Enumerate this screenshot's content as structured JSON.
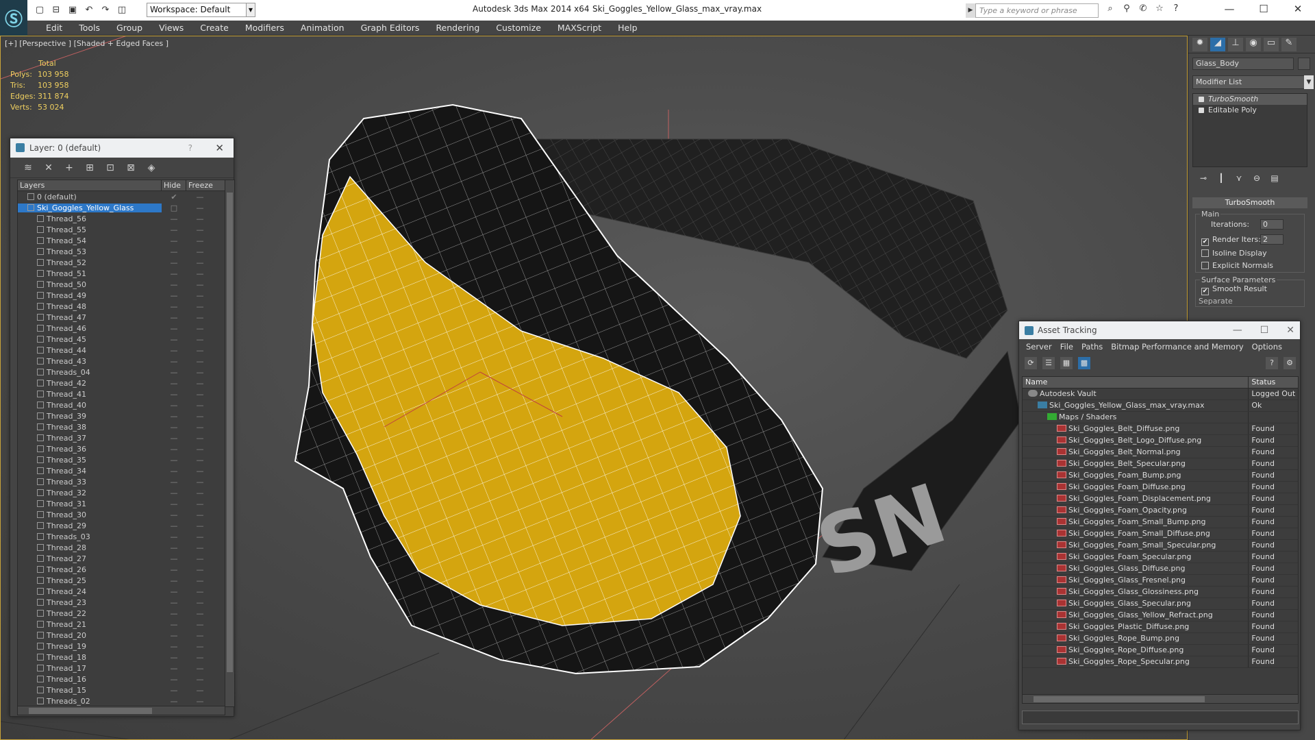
{
  "app": {
    "title": "Autodesk 3ds Max  2014 x64",
    "file": "Ski_Goggles_Yellow_Glass_max_vray.max",
    "workspace": "Workspace: Default",
    "search_placeholder": "Type a keyword or phrase",
    "accent": "#2c6ea8"
  },
  "menu": [
    "Edit",
    "Tools",
    "Group",
    "Views",
    "Create",
    "Modifiers",
    "Animation",
    "Graph Editors",
    "Rendering",
    "Customize",
    "MAXScript",
    "Help"
  ],
  "viewport": {
    "label": "[+] [Perspective ] [Shaded + Edged Faces ]",
    "stats": {
      "header": "Total",
      "rows": [
        {
          "k": "Polys:",
          "v": "103 958"
        },
        {
          "k": "Tris:",
          "v": "103 958"
        },
        {
          "k": "Edges:",
          "v": "311 874"
        },
        {
          "k": "Verts:",
          "v": "53 024"
        }
      ]
    }
  },
  "layer_panel": {
    "title": "Layer: 0 (default)",
    "help": "?",
    "columns": [
      "Layers",
      "Hide",
      "Freeze"
    ],
    "layers": [
      {
        "name": "0 (default)",
        "level": 1,
        "hide": "✔",
        "freeze": "—"
      },
      {
        "name": "Ski_Goggles_Yellow_Glass",
        "level": 1,
        "hide": "□",
        "freeze": "—",
        "selected": true
      },
      {
        "name": "Thread_56",
        "level": 2
      },
      {
        "name": "Thread_55",
        "level": 2
      },
      {
        "name": "Thread_54",
        "level": 2
      },
      {
        "name": "Thread_53",
        "level": 2
      },
      {
        "name": "Thread_52",
        "level": 2
      },
      {
        "name": "Thread_51",
        "level": 2
      },
      {
        "name": "Thread_50",
        "level": 2
      },
      {
        "name": "Thread_49",
        "level": 2
      },
      {
        "name": "Thread_48",
        "level": 2
      },
      {
        "name": "Thread_47",
        "level": 2
      },
      {
        "name": "Thread_46",
        "level": 2
      },
      {
        "name": "Thread_45",
        "level": 2
      },
      {
        "name": "Thread_44",
        "level": 2
      },
      {
        "name": "Thread_43",
        "level": 2
      },
      {
        "name": "Threads_04",
        "level": 2
      },
      {
        "name": "Thread_42",
        "level": 2
      },
      {
        "name": "Thread_41",
        "level": 2
      },
      {
        "name": "Thread_40",
        "level": 2
      },
      {
        "name": "Thread_39",
        "level": 2
      },
      {
        "name": "Thread_38",
        "level": 2
      },
      {
        "name": "Thread_37",
        "level": 2
      },
      {
        "name": "Thread_36",
        "level": 2
      },
      {
        "name": "Thread_35",
        "level": 2
      },
      {
        "name": "Thread_34",
        "level": 2
      },
      {
        "name": "Thread_33",
        "level": 2
      },
      {
        "name": "Thread_32",
        "level": 2
      },
      {
        "name": "Thread_31",
        "level": 2
      },
      {
        "name": "Thread_30",
        "level": 2
      },
      {
        "name": "Thread_29",
        "level": 2
      },
      {
        "name": "Threads_03",
        "level": 2
      },
      {
        "name": "Thread_28",
        "level": 2
      },
      {
        "name": "Thread_27",
        "level": 2
      },
      {
        "name": "Thread_26",
        "level": 2
      },
      {
        "name": "Thread_25",
        "level": 2
      },
      {
        "name": "Thread_24",
        "level": 2
      },
      {
        "name": "Thread_23",
        "level": 2
      },
      {
        "name": "Thread_22",
        "level": 2
      },
      {
        "name": "Thread_21",
        "level": 2
      },
      {
        "name": "Thread_20",
        "level": 2
      },
      {
        "name": "Thread_19",
        "level": 2
      },
      {
        "name": "Thread_18",
        "level": 2
      },
      {
        "name": "Thread_17",
        "level": 2
      },
      {
        "name": "Thread_16",
        "level": 2
      },
      {
        "name": "Thread_15",
        "level": 2
      },
      {
        "name": "Threads_02",
        "level": 2
      }
    ]
  },
  "command_panel": {
    "object_name": "Glass_Body",
    "modifier_list": "Modifier List",
    "stack": [
      "TurboSmooth",
      "Editable Poly"
    ],
    "turbosmooth": {
      "title": "TurboSmooth",
      "main_label": "Main",
      "iterations_label": "Iterations:",
      "iterations": "0",
      "render_iters_label": "Render Iters:",
      "render_iters": "2",
      "isoline": "Isoline Display",
      "explicit": "Explicit Normals",
      "surface_label": "Surface Parameters",
      "smooth_result": "Smooth Result",
      "separate": "Separate"
    }
  },
  "asset_panel": {
    "title": "Asset Tracking",
    "menu": [
      "Server",
      "File",
      "Paths",
      "Bitmap Performance and Memory",
      "Options"
    ],
    "columns": [
      "Name",
      "Status"
    ],
    "rows": [
      {
        "name": "Autodesk Vault",
        "status": "Logged Out",
        "indent": 1,
        "icon": "vault"
      },
      {
        "name": "Ski_Goggles_Yellow_Glass_max_vray.max",
        "status": "Ok",
        "indent": 2,
        "icon": "max"
      },
      {
        "name": "Maps / Shaders",
        "status": "",
        "indent": 3,
        "icon": "map"
      },
      {
        "name": "Ski_Goggles_Belt_Diffuse.png",
        "status": "Found",
        "indent": 4,
        "icon": "png"
      },
      {
        "name": "Ski_Goggles_Belt_Logo_Diffuse.png",
        "status": "Found",
        "indent": 4,
        "icon": "png"
      },
      {
        "name": "Ski_Goggles_Belt_Normal.png",
        "status": "Found",
        "indent": 4,
        "icon": "png"
      },
      {
        "name": "Ski_Goggles_Belt_Specular.png",
        "status": "Found",
        "indent": 4,
        "icon": "png"
      },
      {
        "name": "Ski_Goggles_Foam_Bump.png",
        "status": "Found",
        "indent": 4,
        "icon": "png"
      },
      {
        "name": "Ski_Goggles_Foam_Diffuse.png",
        "status": "Found",
        "indent": 4,
        "icon": "png"
      },
      {
        "name": "Ski_Goggles_Foam_Displacement.png",
        "status": "Found",
        "indent": 4,
        "icon": "png"
      },
      {
        "name": "Ski_Goggles_Foam_Opacity.png",
        "status": "Found",
        "indent": 4,
        "icon": "png"
      },
      {
        "name": "Ski_Goggles_Foam_Small_Bump.png",
        "status": "Found",
        "indent": 4,
        "icon": "png"
      },
      {
        "name": "Ski_Goggles_Foam_Small_Diffuse.png",
        "status": "Found",
        "indent": 4,
        "icon": "png"
      },
      {
        "name": "Ski_Goggles_Foam_Small_Specular.png",
        "status": "Found",
        "indent": 4,
        "icon": "png"
      },
      {
        "name": "Ski_Goggles_Foam_Specular.png",
        "status": "Found",
        "indent": 4,
        "icon": "png"
      },
      {
        "name": "Ski_Goggles_Glass_Diffuse.png",
        "status": "Found",
        "indent": 4,
        "icon": "png"
      },
      {
        "name": "Ski_Goggles_Glass_Fresnel.png",
        "status": "Found",
        "indent": 4,
        "icon": "png"
      },
      {
        "name": "Ski_Goggles_Glass_Glossiness.png",
        "status": "Found",
        "indent": 4,
        "icon": "png"
      },
      {
        "name": "Ski_Goggles_Glass_Specular.png",
        "status": "Found",
        "indent": 4,
        "icon": "png"
      },
      {
        "name": "Ski_Goggles_Glass_Yellow_Refract.png",
        "status": "Found",
        "indent": 4,
        "icon": "png"
      },
      {
        "name": "Ski_Goggles_Plastic_Diffuse.png",
        "status": "Found",
        "indent": 4,
        "icon": "png"
      },
      {
        "name": "Ski_Goggles_Rope_Bump.png",
        "status": "Found",
        "indent": 4,
        "icon": "png"
      },
      {
        "name": "Ski_Goggles_Rope_Diffuse.png",
        "status": "Found",
        "indent": 4,
        "icon": "png"
      },
      {
        "name": "Ski_Goggles_Rope_Specular.png",
        "status": "Found",
        "indent": 4,
        "icon": "png"
      }
    ]
  }
}
